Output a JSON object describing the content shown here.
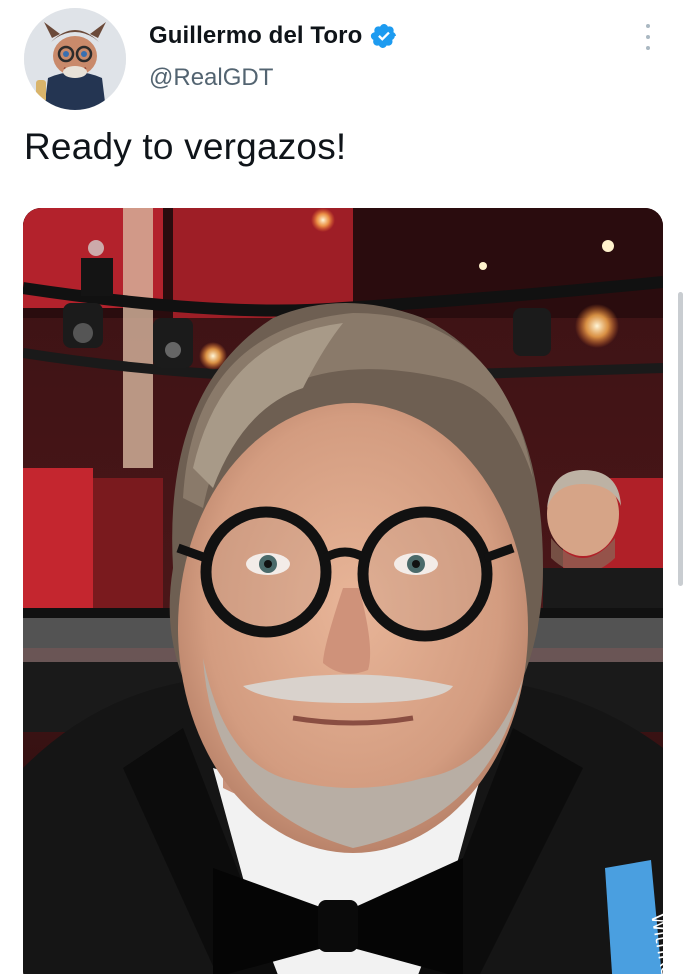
{
  "tweet": {
    "display_name": "Guillermo del Toro",
    "handle": "@RealGDT",
    "text": "Ready to vergazos!",
    "verified": true
  },
  "icons": {
    "verified": "verified-badge-icon",
    "more": "more-options-icon"
  },
  "media": {
    "ribbon_text": "WithRef"
  },
  "colors": {
    "verified_blue": "#1d9bf0",
    "handle_gray": "#536471",
    "text": "#0f1419"
  }
}
